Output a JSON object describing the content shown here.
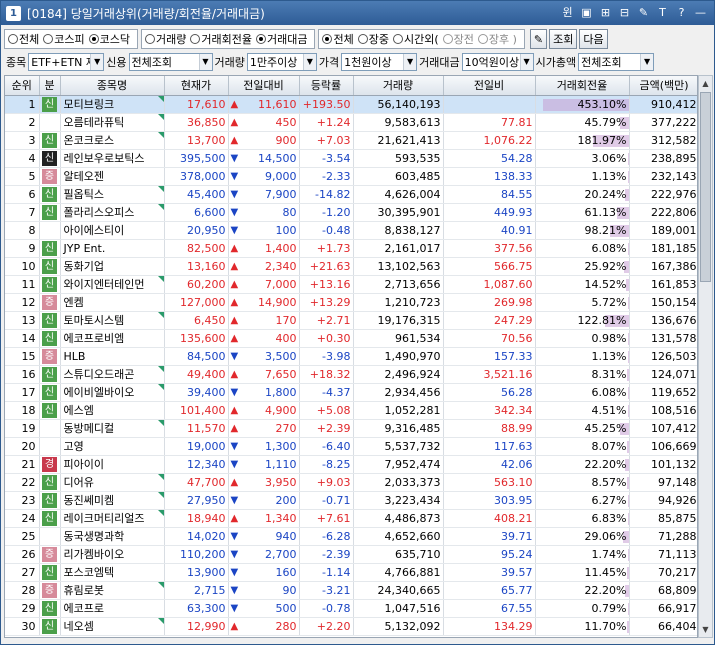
{
  "title": {
    "num": "1",
    "text": "[0184] 당일거래상위(거래량/회전율/거래대금)",
    "tools": [
      "윈",
      "▣",
      "⊞",
      "⊟",
      "✎",
      "T",
      "?",
      "—"
    ]
  },
  "filter1": {
    "market": [
      {
        "label": "전체",
        "on": false
      },
      {
        "label": "코스피",
        "on": false
      },
      {
        "label": "코스닥",
        "on": true
      }
    ],
    "sort": [
      {
        "label": "거래량",
        "on": false
      },
      {
        "label": "거래회전율",
        "on": false
      },
      {
        "label": "거래대금",
        "on": true
      }
    ],
    "session": [
      {
        "label": "전체",
        "on": true
      },
      {
        "label": "장중",
        "on": false
      },
      {
        "label": "시간외(",
        "on": false
      },
      {
        "label": "장전",
        "on": false,
        "dim": true
      },
      {
        "label": "장후 )",
        "on": false,
        "dim": true
      }
    ],
    "btn_pin": "✎",
    "btn_search": "조회",
    "btn_next": "다음"
  },
  "filter2": {
    "item_label": "종목",
    "item_value": "ETF+ETN 제",
    "credit_label": "신용",
    "credit_value": "전체조회",
    "volume_label": "거래량",
    "volume_value": "1만주이상",
    "price_label": "가격",
    "price_value": "1천원이상",
    "amount_label": "거래대금",
    "amount_value": "10억원이상",
    "cap_label": "시가총액",
    "cap_value": "전체조회"
  },
  "columns": [
    "순위",
    "분",
    "종목명",
    "현재가",
    "전일대비",
    "등락률",
    "거래량",
    "전일비",
    "거래회전율",
    "금액(백만)"
  ],
  "rows": [
    {
      "rank": "1",
      "badge": "신",
      "bt": "green",
      "name": "모티브링크",
      "price": "17,610",
      "dir": "up",
      "chg": "11,610",
      "rate": "+193.50",
      "vol": "56,140,193",
      "prev": "",
      "turn": "453.10%",
      "amt": "910,412",
      "sel": true,
      "tri": true,
      "bar": 0.95
    },
    {
      "rank": "2",
      "badge": "",
      "bt": "",
      "name": "오름테라퓨틱",
      "price": "36,850",
      "dir": "up",
      "chg": "450",
      "rate": "+1.24",
      "vol": "9,583,613",
      "prev": "77.81",
      "turn": "45.79%",
      "amt": "377,222",
      "tri": true,
      "bar": 0.1
    },
    {
      "rank": "3",
      "badge": "신",
      "bt": "green",
      "name": "온코크로스",
      "price": "13,700",
      "dir": "up",
      "chg": "900",
      "rate": "+7.03",
      "vol": "21,621,413",
      "prev": "1,076.22",
      "turn": "181.97%",
      "amt": "312,582",
      "tri": true,
      "bar": 0.4
    },
    {
      "rank": "4",
      "badge": "신",
      "bt": "black",
      "name": "레인보우로보틱스",
      "price": "395,500",
      "dir": "dn",
      "chg": "14,500",
      "rate": "-3.54",
      "vol": "593,535",
      "prev": "54.28",
      "turn": "3.06%",
      "amt": "238,895",
      "tri": false,
      "bar": 0.01
    },
    {
      "rank": "5",
      "badge": "증",
      "bt": "pink",
      "name": "알테오젠",
      "price": "378,000",
      "dir": "dn",
      "chg": "9,000",
      "rate": "-2.33",
      "vol": "603,485",
      "prev": "138.33",
      "turn": "1.13%",
      "amt": "232,143",
      "tri": false,
      "bar": 0.005
    },
    {
      "rank": "6",
      "badge": "신",
      "bt": "green",
      "name": "필옵틱스",
      "price": "45,400",
      "dir": "dn",
      "chg": "7,900",
      "rate": "-14.82",
      "vol": "4,626,004",
      "prev": "84.55",
      "turn": "20.24%",
      "amt": "222,976",
      "tri": true,
      "bar": 0.045
    },
    {
      "rank": "7",
      "badge": "신",
      "bt": "green",
      "name": "폴라리스오피스",
      "price": "6,600",
      "dir": "dn",
      "chg": "80",
      "rate": "-1.20",
      "vol": "30,395,901",
      "prev": "449.93",
      "turn": "61.13%",
      "amt": "222,806",
      "tri": true,
      "bar": 0.13
    },
    {
      "rank": "8",
      "badge": "",
      "bt": "",
      "name": "아이에스티이",
      "price": "20,950",
      "dir": "dn",
      "chg": "100",
      "rate": "-0.48",
      "vol": "8,838,127",
      "prev": "40.91",
      "turn": "98.21%",
      "amt": "189,001",
      "tri": false,
      "bar": 0.21
    },
    {
      "rank": "9",
      "badge": "신",
      "bt": "green",
      "name": "JYP Ent.",
      "price": "82,500",
      "dir": "up",
      "chg": "1,400",
      "rate": "+1.73",
      "vol": "2,161,017",
      "prev": "377.56",
      "turn": "6.08%",
      "amt": "181,185",
      "tri": false,
      "bar": 0.013
    },
    {
      "rank": "10",
      "badge": "신",
      "bt": "green",
      "name": "동화기업",
      "price": "13,160",
      "dir": "up",
      "chg": "2,340",
      "rate": "+21.63",
      "vol": "13,102,563",
      "prev": "566.75",
      "turn": "25.92%",
      "amt": "167,386",
      "tri": false,
      "bar": 0.057
    },
    {
      "rank": "11",
      "badge": "신",
      "bt": "green",
      "name": "와이지엔터테인먼",
      "price": "60,200",
      "dir": "up",
      "chg": "7,000",
      "rate": "+13.16",
      "vol": "2,713,656",
      "prev": "1,087.60",
      "turn": "14.52%",
      "amt": "161,853",
      "tri": true,
      "bar": 0.032
    },
    {
      "rank": "12",
      "badge": "증",
      "bt": "pink",
      "name": "엔켐",
      "price": "127,000",
      "dir": "up",
      "chg": "14,900",
      "rate": "+13.29",
      "vol": "1,210,723",
      "prev": "269.98",
      "turn": "5.72%",
      "amt": "150,154",
      "tri": false,
      "bar": 0.012
    },
    {
      "rank": "13",
      "badge": "신",
      "bt": "green",
      "name": "토마토시스템",
      "price": "6,450",
      "dir": "up",
      "chg": "170",
      "rate": "+2.71",
      "vol": "19,176,315",
      "prev": "247.29",
      "turn": "122.81%",
      "amt": "136,676",
      "tri": true,
      "bar": 0.27
    },
    {
      "rank": "14",
      "badge": "신",
      "bt": "green",
      "name": "에코프로비엠",
      "price": "135,600",
      "dir": "up",
      "chg": "400",
      "rate": "+0.30",
      "vol": "961,534",
      "prev": "70.56",
      "turn": "0.98%",
      "amt": "131,578",
      "tri": false,
      "bar": 0.002
    },
    {
      "rank": "15",
      "badge": "증",
      "bt": "pink",
      "name": "HLB",
      "price": "84,500",
      "dir": "dn",
      "chg": "3,500",
      "rate": "-3.98",
      "vol": "1,490,970",
      "prev": "157.33",
      "turn": "1.13%",
      "amt": "126,503",
      "tri": false,
      "bar": 0.002
    },
    {
      "rank": "16",
      "badge": "신",
      "bt": "green",
      "name": "스튜디오드래곤",
      "price": "49,400",
      "dir": "up",
      "chg": "7,650",
      "rate": "+18.32",
      "vol": "2,496,924",
      "prev": "3,521.16",
      "turn": "8.31%",
      "amt": "124,071",
      "tri": true,
      "bar": 0.018
    },
    {
      "rank": "17",
      "badge": "신",
      "bt": "green",
      "name": "에이비엘바이오",
      "price": "39,400",
      "dir": "dn",
      "chg": "1,800",
      "rate": "-4.37",
      "vol": "2,934,456",
      "prev": "56.28",
      "turn": "6.08%",
      "amt": "119,652",
      "tri": true,
      "bar": 0.013
    },
    {
      "rank": "18",
      "badge": "신",
      "bt": "green",
      "name": "에스엠",
      "price": "101,400",
      "dir": "up",
      "chg": "4,900",
      "rate": "+5.08",
      "vol": "1,052,281",
      "prev": "342.34",
      "turn": "4.51%",
      "amt": "108,516",
      "tri": false,
      "bar": 0.01
    },
    {
      "rank": "19",
      "badge": "",
      "bt": "",
      "name": "동방메디컬",
      "price": "11,570",
      "dir": "up",
      "chg": "270",
      "rate": "+2.39",
      "vol": "9,316,485",
      "prev": "88.99",
      "turn": "45.25%",
      "amt": "107,412",
      "tri": true,
      "bar": 0.1
    },
    {
      "rank": "20",
      "badge": "",
      "bt": "",
      "name": "고영",
      "price": "19,000",
      "dir": "dn",
      "chg": "1,300",
      "rate": "-6.40",
      "vol": "5,537,732",
      "prev": "117.63",
      "turn": "8.07%",
      "amt": "106,669",
      "tri": false,
      "bar": 0.018
    },
    {
      "rank": "21",
      "badge": "경",
      "bt": "red",
      "name": "피아이이",
      "price": "12,340",
      "dir": "dn",
      "chg": "1,110",
      "rate": "-8.25",
      "vol": "7,952,474",
      "prev": "42.06",
      "turn": "22.20%",
      "amt": "101,132",
      "tri": false,
      "bar": 0.049
    },
    {
      "rank": "22",
      "badge": "신",
      "bt": "green",
      "name": "디어유",
      "price": "47,700",
      "dir": "up",
      "chg": "3,950",
      "rate": "+9.03",
      "vol": "2,033,373",
      "prev": "563.10",
      "turn": "8.57%",
      "amt": "97,148",
      "tri": true,
      "bar": 0.019
    },
    {
      "rank": "23",
      "badge": "신",
      "bt": "green",
      "name": "동진쎄미켐",
      "price": "27,950",
      "dir": "dn",
      "chg": "200",
      "rate": "-0.71",
      "vol": "3,223,434",
      "prev": "303.95",
      "turn": "6.27%",
      "amt": "94,926",
      "tri": true,
      "bar": 0.014
    },
    {
      "rank": "24",
      "badge": "신",
      "bt": "green",
      "name": "레이크머티리얼즈",
      "price": "18,940",
      "dir": "up",
      "chg": "1,340",
      "rate": "+7.61",
      "vol": "4,486,873",
      "prev": "408.21",
      "turn": "6.83%",
      "amt": "85,875",
      "tri": true,
      "bar": 0.015
    },
    {
      "rank": "25",
      "badge": "",
      "bt": "",
      "name": "동국생명과학",
      "price": "14,020",
      "dir": "dn",
      "chg": "940",
      "rate": "-6.28",
      "vol": "4,652,660",
      "prev": "39.71",
      "turn": "29.06%",
      "amt": "71,288",
      "tri": false,
      "bar": 0.064
    },
    {
      "rank": "26",
      "badge": "증",
      "bt": "pink",
      "name": "리가켐바이오",
      "price": "110,200",
      "dir": "dn",
      "chg": "2,700",
      "rate": "-2.39",
      "vol": "635,710",
      "prev": "95.24",
      "turn": "1.74%",
      "amt": "71,113",
      "tri": false,
      "bar": 0.004
    },
    {
      "rank": "27",
      "badge": "신",
      "bt": "green",
      "name": "포스코엠텍",
      "price": "13,900",
      "dir": "dn",
      "chg": "160",
      "rate": "-1.14",
      "vol": "4,766,881",
      "prev": "39.57",
      "turn": "11.45%",
      "amt": "70,217",
      "tri": false,
      "bar": 0.025
    },
    {
      "rank": "28",
      "badge": "증",
      "bt": "pink",
      "name": "휴림로봇",
      "price": "2,715",
      "dir": "dn",
      "chg": "90",
      "rate": "-3.21",
      "vol": "24,340,665",
      "prev": "65.77",
      "turn": "22.20%",
      "amt": "68,809",
      "tri": true,
      "bar": 0.049
    },
    {
      "rank": "29",
      "badge": "신",
      "bt": "green",
      "name": "에코프로",
      "price": "63,300",
      "dir": "dn",
      "chg": "500",
      "rate": "-0.78",
      "vol": "1,047,516",
      "prev": "67.55",
      "turn": "0.79%",
      "amt": "66,917",
      "tri": false,
      "bar": 0.002
    },
    {
      "rank": "30",
      "badge": "신",
      "bt": "green",
      "name": "네오셈",
      "price": "12,990",
      "dir": "up",
      "chg": "280",
      "rate": "+2.20",
      "vol": "5,132,092",
      "prev": "134.29",
      "turn": "11.70%",
      "amt": "66,404",
      "tri": true,
      "bar": 0.026
    }
  ],
  "colors": {
    "up": "#e1282c",
    "down": "#1b45c4",
    "selected_row": "#cfe3f7",
    "title_bar": "#2e5c96"
  }
}
